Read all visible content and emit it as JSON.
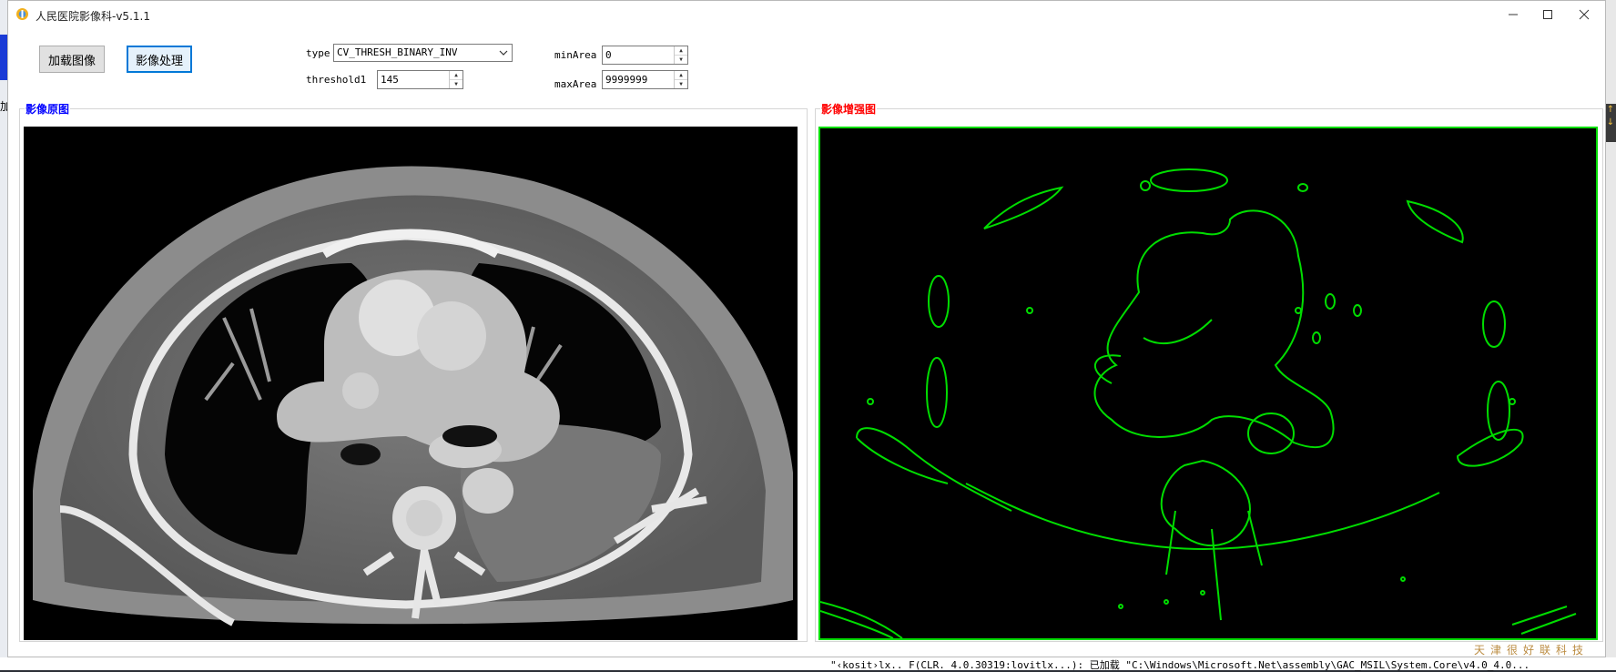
{
  "window": {
    "title": "人民医院影像科-v5.1.1"
  },
  "toolbar": {
    "load_label": "加载图像",
    "process_label": "影像处理",
    "type_label": "type",
    "type_value": "CV_THRESH_BINARY_INV",
    "threshold_label": "threshold1",
    "threshold_value": "145",
    "minarea_label": "minArea",
    "minarea_value": "0",
    "maxarea_label": "maxArea",
    "maxarea_value": "9999999"
  },
  "panels": {
    "original_title": "影像原图",
    "enhanced_title": "影像增强图"
  },
  "background": {
    "left_text": "加",
    "log_text": "\"‹kosit›lx.. F(CLR. 4.0.30319:lovitlx...): 已加载 \"C:\\Windows\\Microsoft.Net\\assembly\\GAC_MSIL\\System.Core\\v4.0_4.0..."
  },
  "colors": {
    "original_title": "#0000ff",
    "enhanced_title": "#ff0000",
    "contour": "#00dd00",
    "focus_border": "#0078d7"
  }
}
